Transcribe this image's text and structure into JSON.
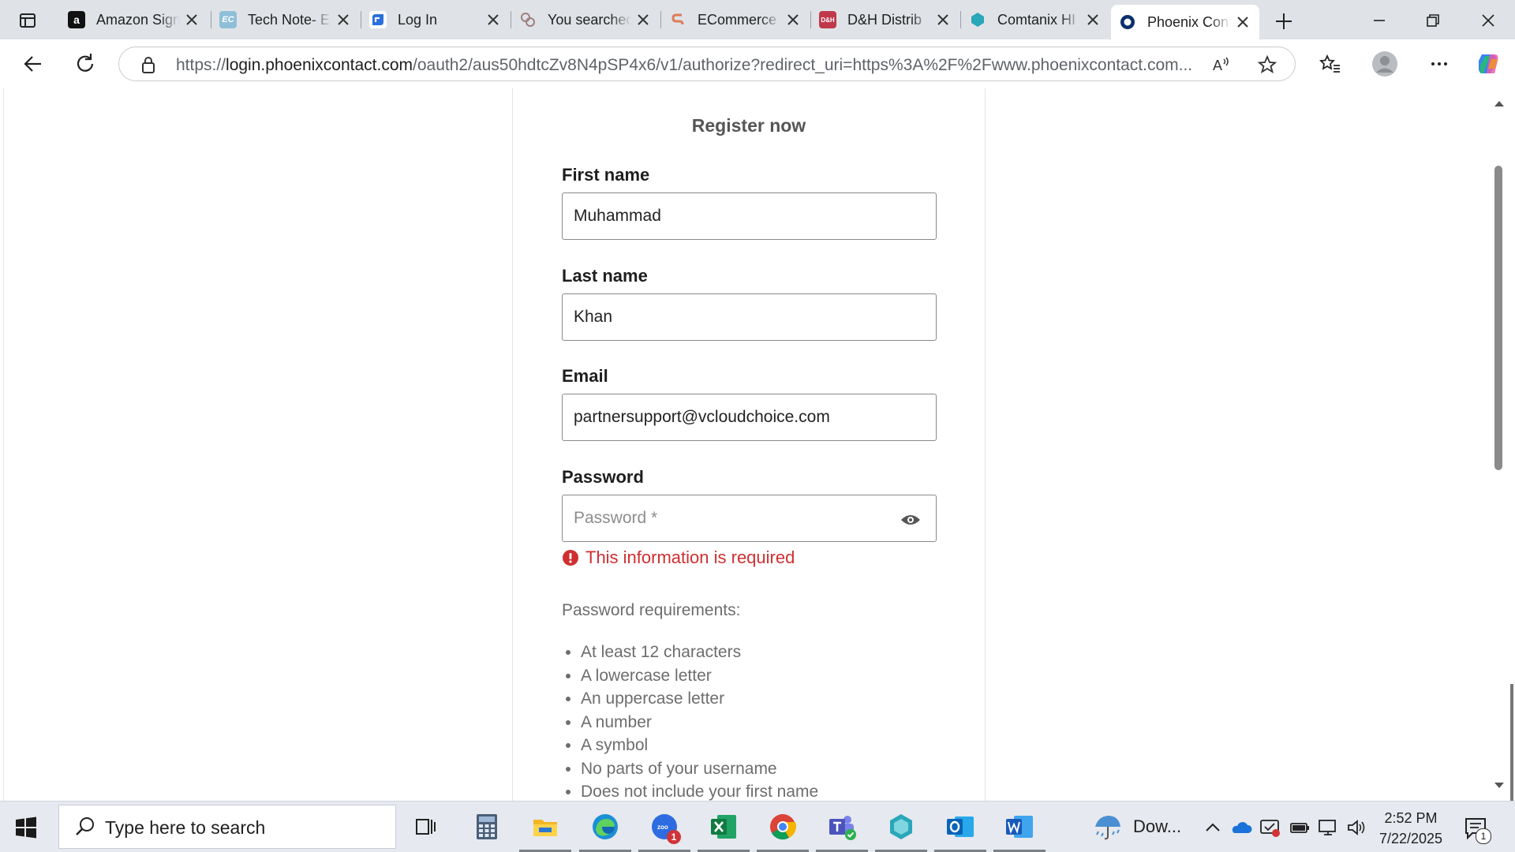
{
  "browser": {
    "tabs": [
      {
        "title": "Amazon Sign-In",
        "favicon": "amazon-icon",
        "fav_color": "#111111",
        "fav_text": "a"
      },
      {
        "title": "Tech Note- E",
        "favicon": "ec-icon",
        "fav_color": "#8fbfd8",
        "fav_text": "EC"
      },
      {
        "title": "Log In",
        "favicon": "login-icon",
        "fav_color": "#2a6fdb",
        "fav_text": ""
      },
      {
        "title": "You searched",
        "favicon": "search-results-icon",
        "fav_color": "#c9a0a0",
        "fav_text": ""
      },
      {
        "title": "ECommerce",
        "favicon": "ecommerce-icon",
        "fav_color": "#e07a5a",
        "fav_text": ""
      },
      {
        "title": "D&H Distrib",
        "favicon": "dh-icon",
        "fav_color": "#c0394a",
        "fav_text": "D&H"
      },
      {
        "title": "Comtanix HI",
        "favicon": "comtanix-icon",
        "fav_color": "#2aa7b8",
        "fav_text": ""
      },
      {
        "title": "Phoenix Contact",
        "favicon": "phoenix-icon",
        "fav_color": "#0b2f6b",
        "fav_text": "",
        "active": true
      }
    ],
    "url_prefix": "https://",
    "url_host": "login.phoenixcontact.com",
    "url_rest": "/oauth2/aus50hdtcZv8N4pSP4x6/v1/authorize?redirect_uri=https%3A%2F%2Fwww.phoenixcontact.com..."
  },
  "form": {
    "heading": "Register now",
    "first_name_label": "First name",
    "first_name_value": "Muhammad",
    "last_name_label": "Last name",
    "last_name_value": "Khan",
    "email_label": "Email",
    "email_value": "partnersupport@vcloudchoice.com",
    "password_label": "Password",
    "password_placeholder": "Password *",
    "password_error": "This information is required",
    "requirements_title": "Password requirements:",
    "requirements": [
      "At least 12 characters",
      "A lowercase letter",
      "An uppercase letter",
      "A number",
      "A symbol",
      "No parts of your username",
      "Does not include your first name"
    ]
  },
  "taskbar": {
    "search_placeholder": "Type here to search",
    "weather_text": "Dow...",
    "time": "2:52 PM",
    "date": "7/22/2025",
    "zoom_badge": "1",
    "notification_count": "1"
  },
  "colors": {
    "error": "#cf2f30",
    "tab_strip": "#dfe3e7",
    "taskbar": "#e6e9ef"
  }
}
